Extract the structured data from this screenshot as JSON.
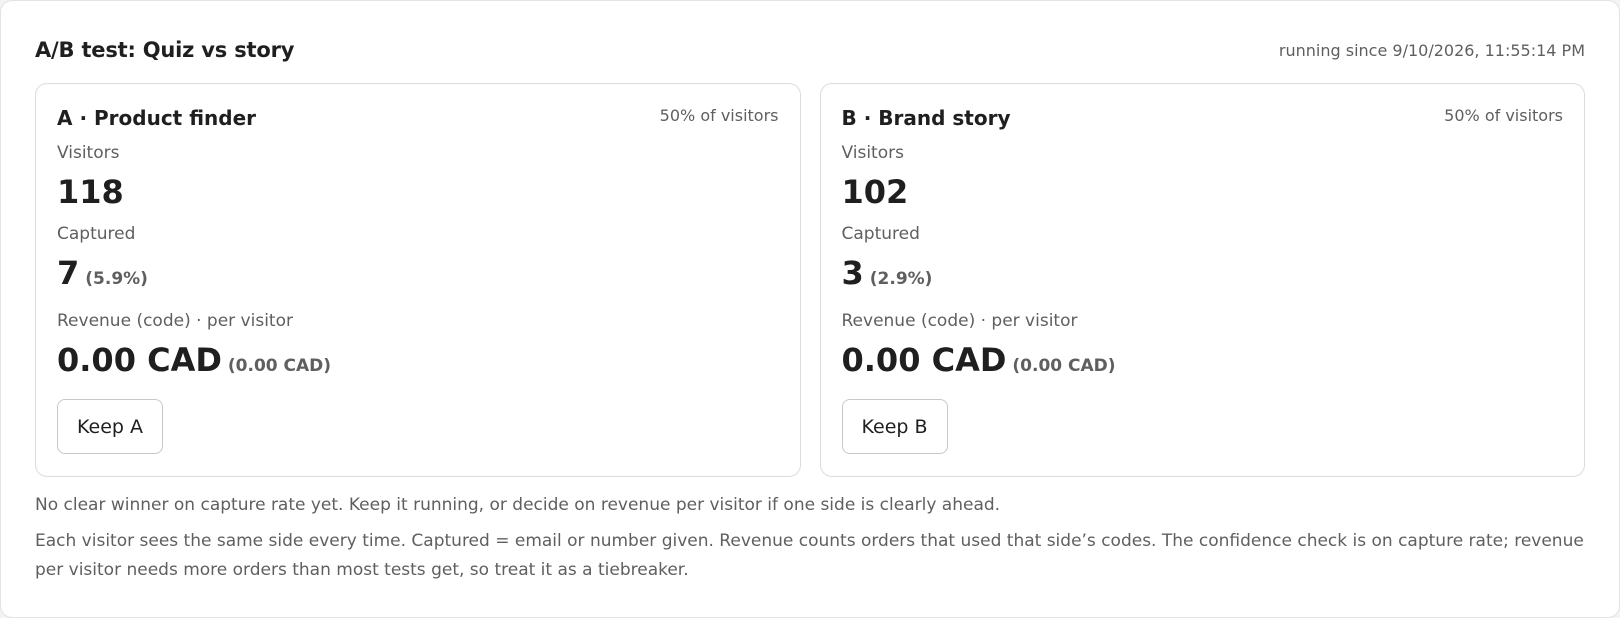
{
  "test": {
    "title": "A/B test: Quiz vs story",
    "running_since": "running since 9/10/2026, 11:55:14 PM"
  },
  "variants": [
    {
      "name": "A · Product finder",
      "split": "50% of visitors",
      "visitors_label": "Visitors",
      "visitors": "118",
      "captured_label": "Captured",
      "captured": "7",
      "captured_rate": "(5.9%)",
      "revenue_label": "Revenue (code) · per visitor",
      "revenue": "0.00 CAD",
      "revenue_per_visitor": "(0.00 CAD)",
      "keep_label": "Keep A"
    },
    {
      "name": "B · Brand story",
      "split": "50% of visitors",
      "visitors_label": "Visitors",
      "visitors": "102",
      "captured_label": "Captured",
      "captured": "3",
      "captured_rate": "(2.9%)",
      "revenue_label": "Revenue (code) · per visitor",
      "revenue": "0.00 CAD",
      "revenue_per_visitor": "(0.00 CAD)",
      "keep_label": "Keep B"
    }
  ],
  "notes": {
    "verdict": "No clear winner on capture rate yet. Keep it running, or decide on revenue per visitor if one side is clearly ahead.",
    "explanation": "Each visitor sees the same side every time. Captured = email or number given. Revenue counts orders that used that side’s codes. The confidence check is on capture rate; revenue per visitor needs more orders than most tests get, so treat it as a tiebreaker."
  }
}
